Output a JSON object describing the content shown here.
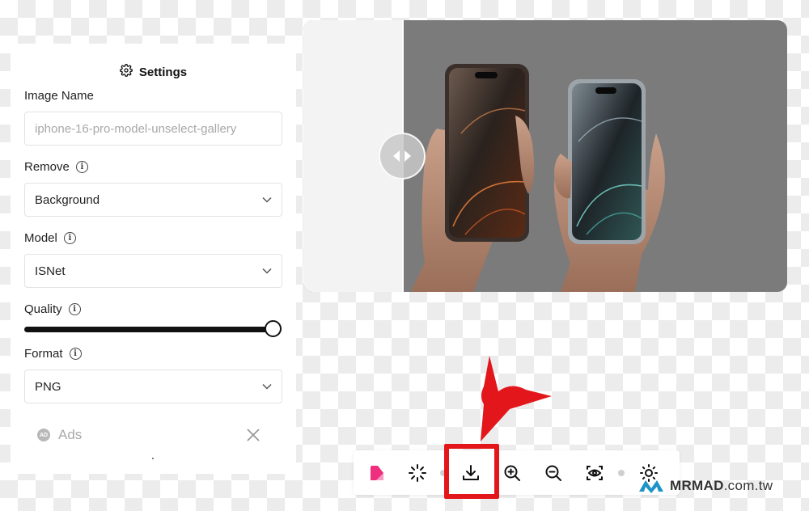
{
  "settings": {
    "title": "Settings",
    "image_name": {
      "label": "Image Name",
      "value": "iphone-16-pro-model-unselect-gallery"
    },
    "remove": {
      "label": "Remove",
      "selected": "Background"
    },
    "model": {
      "label": "Model",
      "selected": "ISNet"
    },
    "quality": {
      "label": "Quality",
      "value": 1.0
    },
    "format": {
      "label": "Format",
      "selected": "PNG"
    },
    "ads": {
      "label": "Ads",
      "badge": "AD"
    }
  },
  "toolbar": {
    "items": [
      "brand-logo",
      "magic-select",
      "download",
      "zoom-in",
      "zoom-out",
      "preview-eye",
      "brightness"
    ]
  },
  "watermark": {
    "brand": "MRMAD",
    "domain": ".com.tw"
  },
  "colors": {
    "highlight": "#e3161b",
    "accent_pink": "#ef2f7e"
  }
}
